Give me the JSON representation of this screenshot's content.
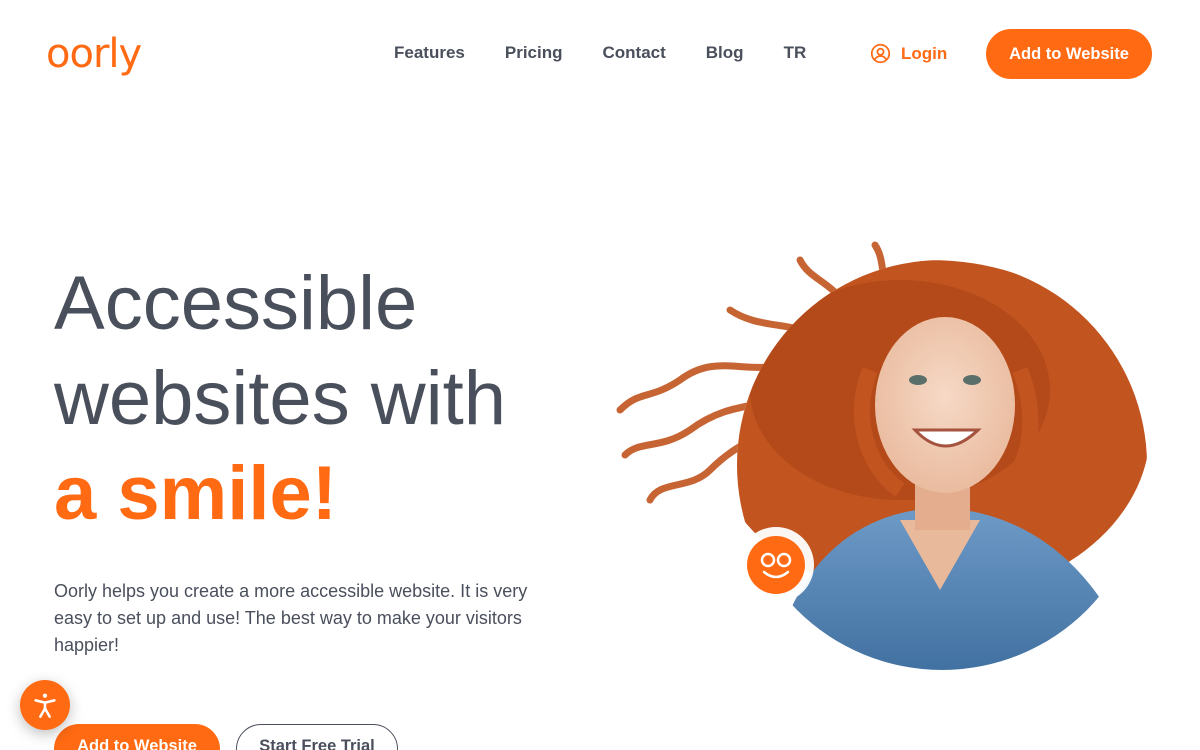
{
  "header": {
    "logo_text": "oorly",
    "nav": [
      "Features",
      "Pricing",
      "Contact",
      "Blog",
      "TR"
    ],
    "login_label": "Login",
    "cta_label": "Add to Website"
  },
  "hero": {
    "headline_line1": "Accessible",
    "headline_line2": "websites with",
    "headline_accent": "a smile!",
    "lead": "Oorly helps you create a more accessible website. It is very easy to set up and use! The best way to make your visitors happier!",
    "primary_button": "Add to Website",
    "secondary_button": "Start Free Trial"
  },
  "icons": {
    "login": "user-circle-icon",
    "accessibility": "accessibility-person-icon",
    "badge": "oorly-smile-badge-icon"
  },
  "colors": {
    "brand": "#ff6a13",
    "text": "#4a4f5c",
    "denim": "#4f7fb3",
    "hair": "#c2541f"
  }
}
